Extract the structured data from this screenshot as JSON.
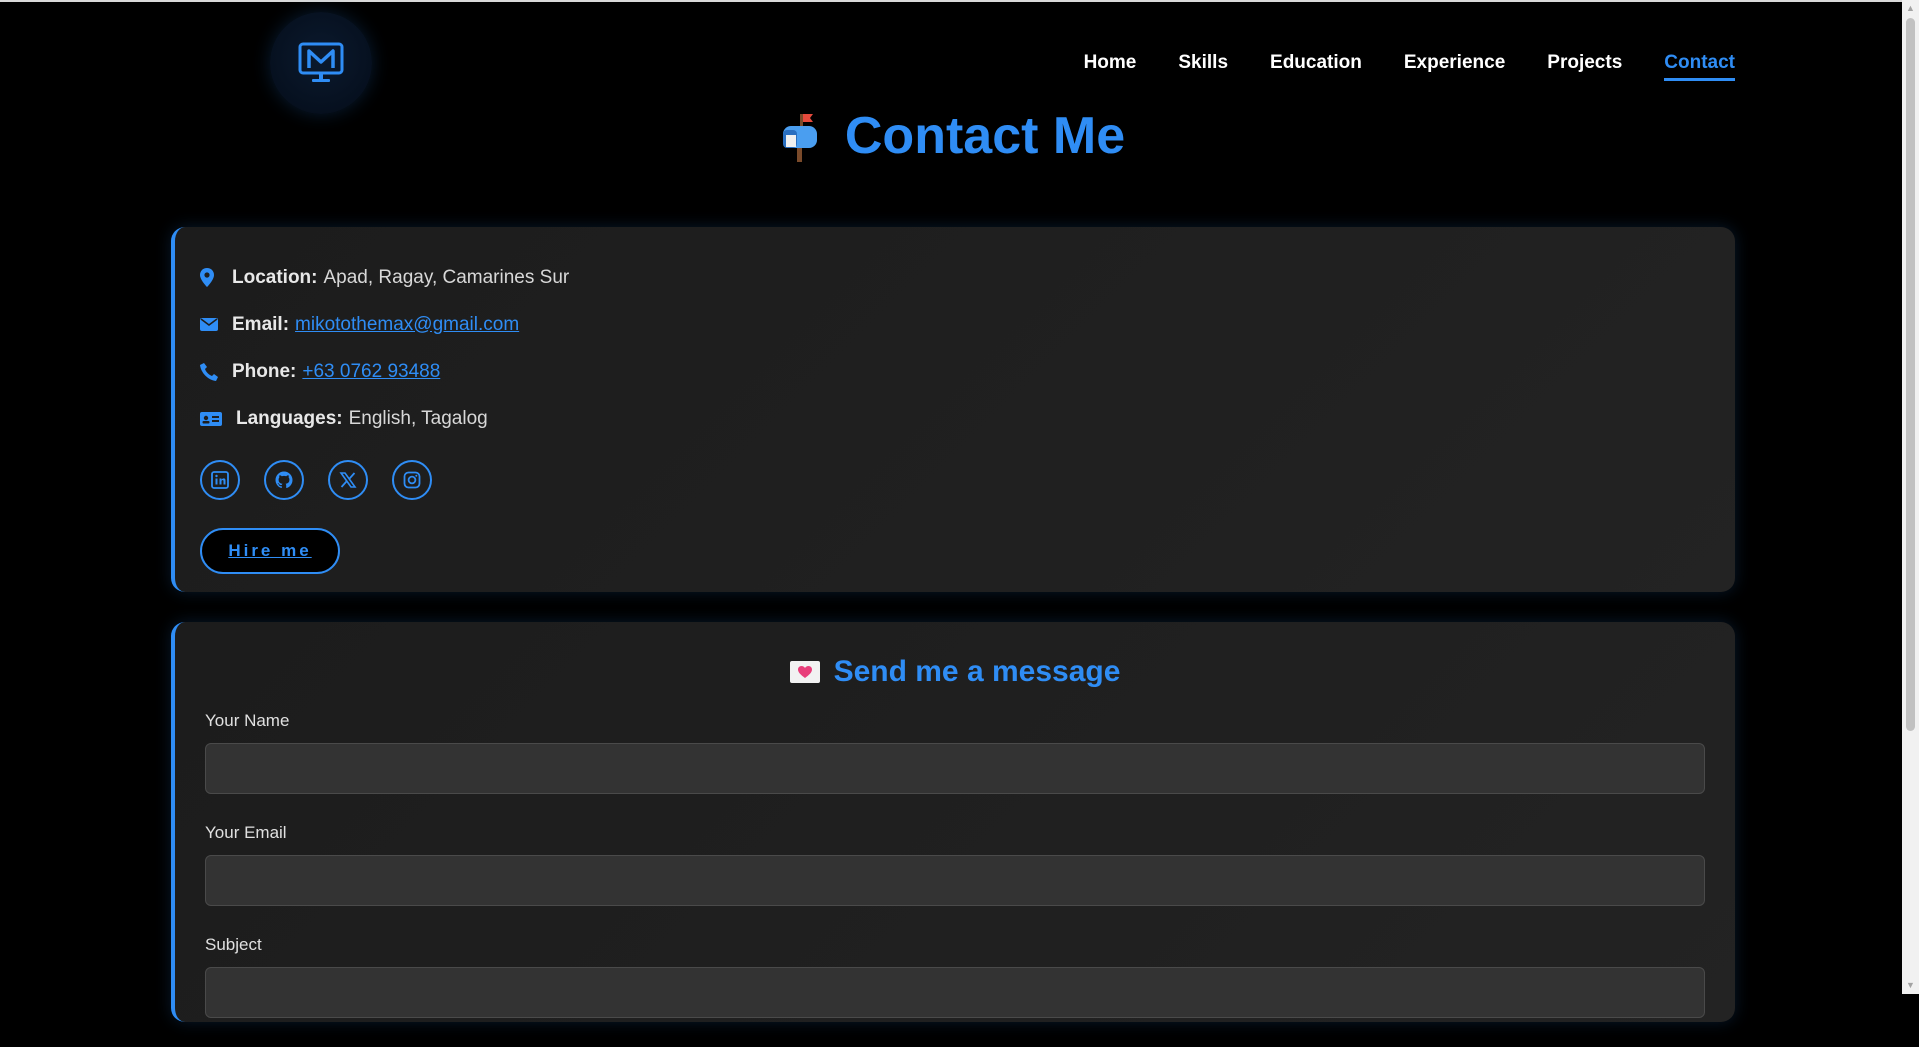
{
  "nav": {
    "items": [
      {
        "label": "Home"
      },
      {
        "label": "Skills"
      },
      {
        "label": "Education"
      },
      {
        "label": "Experience"
      },
      {
        "label": "Projects"
      },
      {
        "label": "Contact",
        "active": true
      }
    ]
  },
  "page": {
    "title": "Contact Me",
    "title_icon": "mailbox-icon"
  },
  "contact": {
    "location_label": "Location:",
    "location_value": "Apad, Ragay, Camarines Sur",
    "email_label": "Email:",
    "email_value": "mikotothemax@gmail.com",
    "phone_label": "Phone:",
    "phone_value": "+63 0762 93488",
    "languages_label": "Languages:",
    "languages_value": "English, Tagalog",
    "socials": [
      "linkedin-icon",
      "github-icon",
      "x-icon",
      "instagram-icon"
    ],
    "hire_label": "Hire me"
  },
  "form": {
    "title": "Send me a message",
    "name_label": "Your Name",
    "email_label": "Your Email",
    "subject_label": "Subject"
  },
  "colors": {
    "accent": "#2f8df5",
    "background": "#000000",
    "card": "#1f1f1f"
  }
}
